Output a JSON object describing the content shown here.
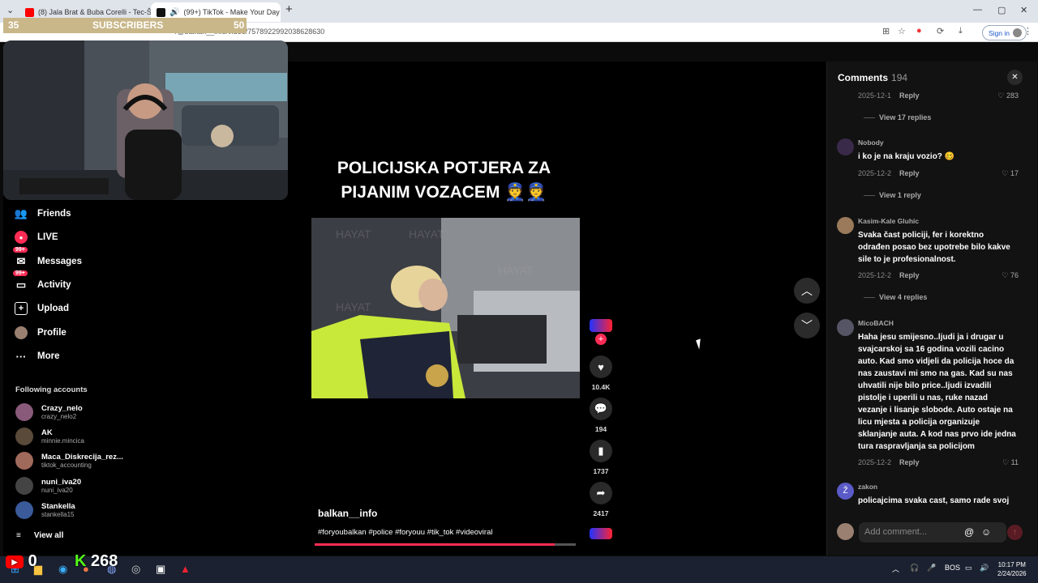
{
  "browser": {
    "tabs": [
      {
        "label": "(8) Jala Brat & Buba Corelli - Tec-Š",
        "color": "#ff0000"
      },
      {
        "label": "(99+) TikTok - Make Your Day",
        "color": "#111111"
      }
    ],
    "url": "/@balkan__info/video/7578922992038628630",
    "signin_label": "Sign in"
  },
  "stream_overlay": {
    "subs_left": "35",
    "subs_label": "SUBSCRIBERS",
    "subs_right": "50",
    "yt_count": "0",
    "kick_count": "268"
  },
  "sidebar": {
    "items": [
      {
        "label": "Friends",
        "icon": "friends-icon"
      },
      {
        "label": "LIVE",
        "icon": "live-icon"
      },
      {
        "label": "Messages",
        "icon": "messages-icon",
        "badge": "99+"
      },
      {
        "label": "Activity",
        "icon": "activity-icon",
        "badge": "99+"
      },
      {
        "label": "Upload",
        "icon": "upload-icon"
      },
      {
        "label": "Profile",
        "icon": "profile-icon"
      },
      {
        "label": "More",
        "icon": "more-icon"
      }
    ],
    "following_title": "Following accounts",
    "accounts": [
      {
        "name": "Crazy_nelo",
        "handle": "crazy_nelo2"
      },
      {
        "name": "AK",
        "handle": "minnie.mincica"
      },
      {
        "name": "Maca_Diskrecija_rez...",
        "handle": "tiktok_accounting"
      },
      {
        "name": "nuni_iva20",
        "handle": "nuni_iva20"
      },
      {
        "name": "Stankella",
        "handle": "stankella15"
      }
    ],
    "view_all": "View all"
  },
  "video": {
    "title_line1": "POLICIJSKA POTJERA ZA",
    "title_line2": "PIJANIM VOZACEM 👮👮",
    "watermark": "HAYAT",
    "author": "balkan__info",
    "hashtags": "#foryoubalkan #police #foryouu #tik_tok #videoviral",
    "progress": 0.92,
    "likes": "10.4K",
    "comments": "194",
    "saves": "1737",
    "shares": "2417"
  },
  "comments_panel": {
    "title": "Comments",
    "count": "194",
    "reply_label": "Reply",
    "top_date": "2025-12-1",
    "top_likes": "283",
    "items": [
      {
        "user": "Nobody",
        "text": "i ko je na kraju vozio? 🥴",
        "date": "2025-12-2",
        "likes": "17",
        "view_replies": "View 1 reply"
      },
      {
        "user": "Kasim-Kale Gluhic",
        "text": "Svaka čast policiji, fer i korektno odrađen posao bez upotrebe bilo kakve sile to je profesionalnost.",
        "date": "2025-12-2",
        "likes": "76",
        "view_replies": "View 4 replies"
      },
      {
        "user": "MicoΒΑСН",
        "text": "Haha jesu smijesno..ljudi ja i drugar u svajcarskoj sa 16 godina vozili cacino auto. Kad smo vidjeli da policija hoce da nas zaustavi mi smo na gas. Kad su nas uhvatili nije bilo price..ljudi izvadili pistolje i uperili u nas, ruke nazad vezanje i lisanje slobode. Auto ostaje na licu mjesta a policija organizuje sklanjanje auta. A kod nas prvo ide jedna tura raspravljanja sa policijom",
        "date": "2025-12-2",
        "likes": "11"
      },
      {
        "user": "zakon",
        "text": "policajcima svaka cast, samo rade svoj"
      }
    ],
    "top_view_replies": "View 17 replies",
    "add_placeholder": "Add comment..."
  },
  "taskbar": {
    "lang": "BOS",
    "time": "10:17 PM",
    "date": "2/24/2026"
  }
}
